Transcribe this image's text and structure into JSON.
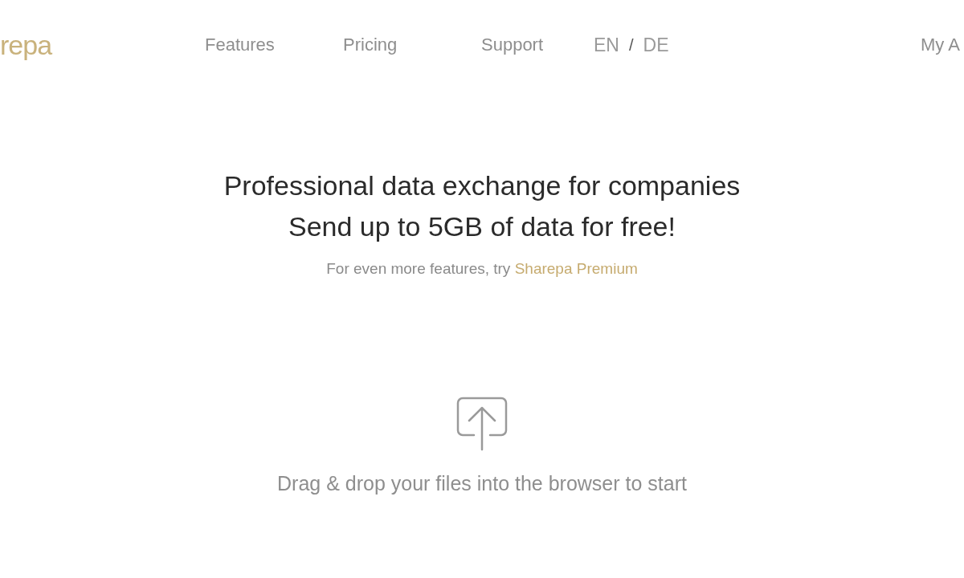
{
  "header": {
    "logo": "repa",
    "nav": [
      {
        "label": "Features"
      },
      {
        "label": "Pricing"
      },
      {
        "label": "Support"
      }
    ],
    "languages": [
      {
        "label": "EN"
      },
      {
        "label": "DE"
      }
    ],
    "language_separator": "/",
    "account_link": "My A"
  },
  "hero": {
    "title_lines": [
      "Professional data exchange for companies",
      "Send up to 5GB of data for free!"
    ],
    "subtitle": "For even more features, try",
    "premium_link": "Sharepa Premium"
  },
  "upload": {
    "hint": "Drag & drop your files into the browser to start"
  }
}
